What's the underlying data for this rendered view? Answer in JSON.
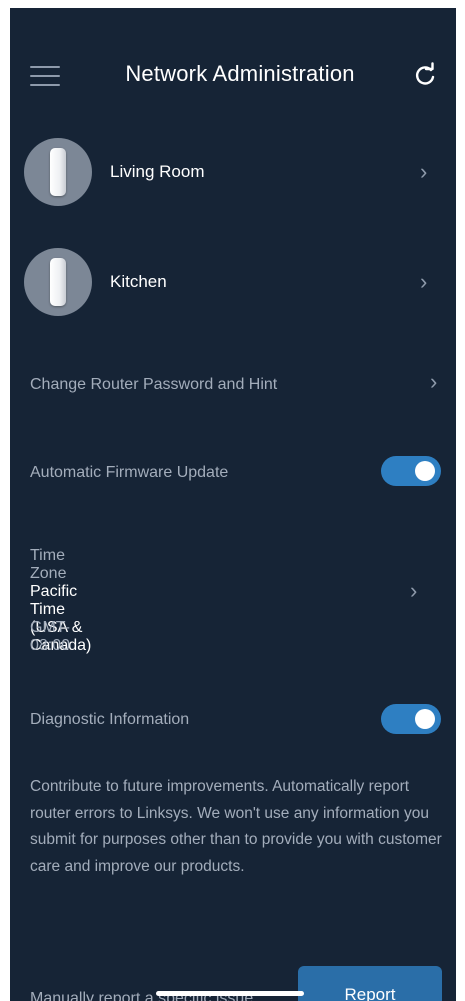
{
  "header": {
    "title": "Network Administration",
    "menu_icon": "hamburger-menu-icon",
    "refresh_icon": "refresh-icon"
  },
  "nodes": [
    {
      "label": "Living Room",
      "icon": "router-node-icon"
    },
    {
      "label": "Kitchen",
      "icon": "router-node-icon"
    }
  ],
  "settings": {
    "router_password": {
      "label": "Change Router Password and Hint"
    },
    "firmware": {
      "label": "Automatic Firmware Update",
      "enabled": true
    },
    "time_zone": {
      "label": "Time Zone",
      "value": "Pacific Time (USA & Canada)",
      "offset": "GMT-08:00"
    },
    "diagnostics": {
      "label": "Diagnostic Information",
      "enabled": true,
      "description": "Contribute to future improvements. Automatically report router errors to Linksys. We won't use any information you submit for purposes other than to provide you with customer care and improve our products."
    },
    "manual_report": {
      "label": "Manually report a specific issue",
      "button_label": "Report"
    }
  },
  "colors": {
    "background": "#162436",
    "accent": "#2e7fc2",
    "muted_text": "#a3adbb"
  }
}
